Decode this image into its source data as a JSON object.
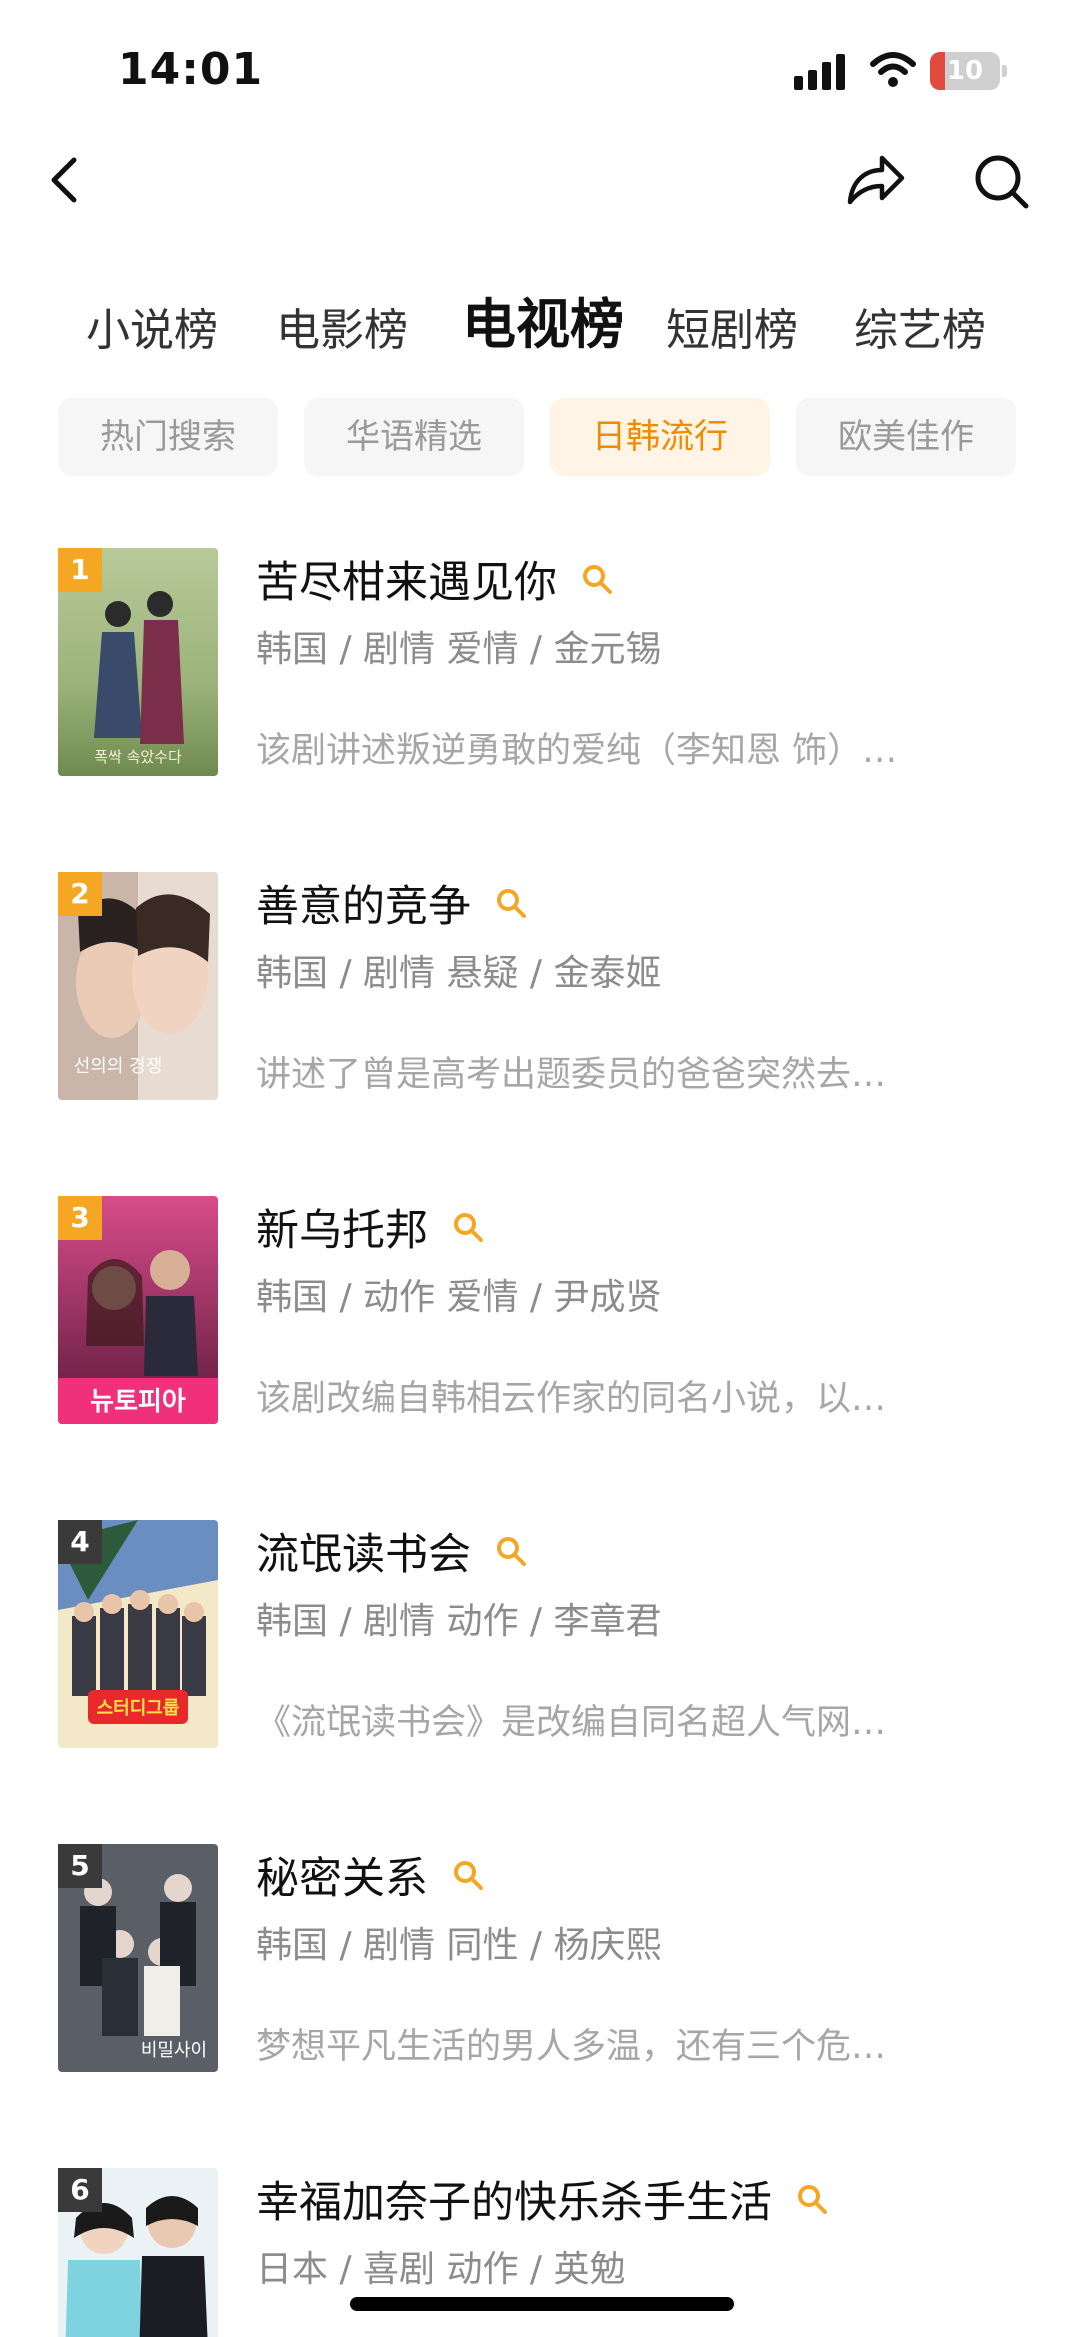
{
  "status_bar": {
    "time": "14:01",
    "battery_level": "10",
    "battery_fraction": 0.1,
    "icons": [
      "signal-icon",
      "wifi-icon",
      "battery-icon"
    ]
  },
  "nav": {
    "back_icon": "chevron-left-icon",
    "share_icon": "share-icon",
    "search_icon": "search-icon"
  },
  "main_tabs": [
    {
      "label": "小说榜",
      "active": false
    },
    {
      "label": "电影榜",
      "active": false
    },
    {
      "label": "电视榜",
      "active": true
    },
    {
      "label": "短剧榜",
      "active": false
    },
    {
      "label": "综艺榜",
      "active": false
    }
  ],
  "sub_tabs": [
    {
      "label": "热门搜索",
      "active": false
    },
    {
      "label": "华语精选",
      "active": false
    },
    {
      "label": "日韩流行",
      "active": true
    },
    {
      "label": "欧美佳作",
      "active": false
    }
  ],
  "colors": {
    "accent": "#f08a00",
    "rank_top3": "#f5a623",
    "rank_other": "#3a3a3a",
    "meta_text": "#8c8c8c"
  },
  "items": [
    {
      "rank": "1",
      "title": "苦尽柑来遇见你",
      "meta": "韩国 / 剧情 爱情 / 金元锡",
      "desc": "该剧讲述叛逆勇敢的爱纯（李知恩 饰）…",
      "poster_text": "폭싹 속았수다"
    },
    {
      "rank": "2",
      "title": "善意的竞争",
      "meta": "韩国 / 剧情 悬疑 / 金泰姬",
      "desc": "讲述了曾是高考出题委员的爸爸突然去…",
      "poster_text": "선의의 경쟁"
    },
    {
      "rank": "3",
      "title": "新乌托邦",
      "meta": "韩国 / 动作 爱情 / 尹成贤",
      "desc": "该剧改编自韩相云作家的同名小说，以…",
      "poster_text": "뉴토피아"
    },
    {
      "rank": "4",
      "title": "流氓读书会",
      "meta": "韩国 / 剧情 动作 / 李章君",
      "desc": "《流氓读书会》是改编自同名超人气网…",
      "poster_text": "스터디그룹"
    },
    {
      "rank": "5",
      "title": "秘密关系",
      "meta": "韩国 / 剧情 同性 / 杨庆熙",
      "desc": "梦想平凡生活的男人多温，还有三个危…",
      "poster_text": "비밀사이"
    },
    {
      "rank": "6",
      "title": "幸福加奈子的快乐杀手生活",
      "meta": "日本 / 喜剧 动作 / 英勉",
      "desc": "",
      "poster_text": ""
    }
  ]
}
